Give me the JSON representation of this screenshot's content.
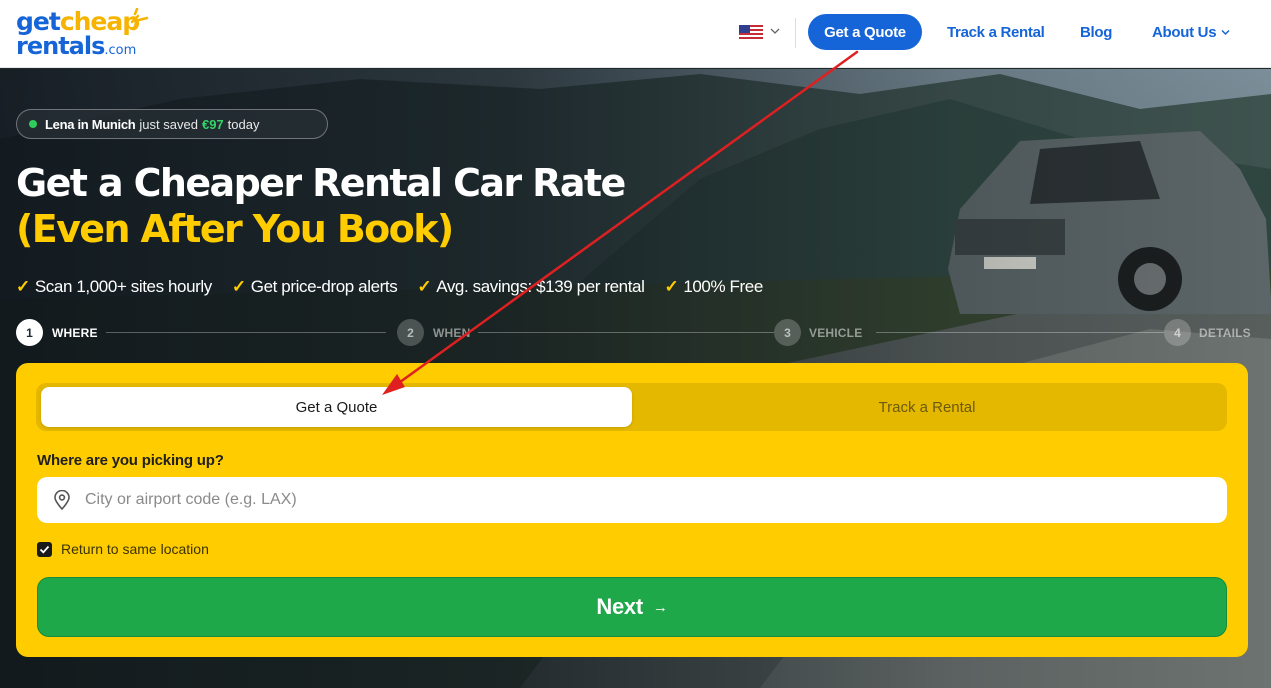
{
  "header": {
    "logo": {
      "part1": "get",
      "part2": "cheap",
      "part3": "rentals",
      "part4": ".com"
    },
    "flag_icon": "us-flag-icon",
    "nav": {
      "quote_button": "Get a Quote",
      "track": "Track a Rental",
      "blog": "Blog",
      "about": "About Us"
    }
  },
  "hero": {
    "social_proof": {
      "who": "Lena in Munich",
      "mid": "just saved",
      "amount": "€97",
      "when": "today"
    },
    "title_line1": "Get a Cheaper Rental Car Rate",
    "title_line2": "(Even After You Book)",
    "perks": [
      "Scan 1,000+ sites hourly",
      "Get price-drop alerts",
      "Avg. savings: $139 per rental",
      "100% Free"
    ],
    "checkmark": "✓"
  },
  "stepper": {
    "steps": [
      {
        "num": "1",
        "label": "WHERE",
        "active": true
      },
      {
        "num": "2",
        "label": "WHEN",
        "active": false
      },
      {
        "num": "3",
        "label": "VEHICLE",
        "active": false
      },
      {
        "num": "4",
        "label": "DETAILS",
        "active": false
      }
    ]
  },
  "form": {
    "tabs": {
      "active": "Get a Quote",
      "inactive": "Track a Rental"
    },
    "pickup_label": "Where are you picking up?",
    "pickup_placeholder": "City or airport code (e.g. LAX)",
    "pickup_value": "",
    "return_same": {
      "label": "Return to same location",
      "checked": true
    },
    "next_button": "Next",
    "next_arrow": "→"
  },
  "colors": {
    "brand_blue": "#1565d8",
    "accent_yellow": "#ffcc00",
    "next_green": "#1fa84a",
    "annotation_red": "#e02020"
  }
}
